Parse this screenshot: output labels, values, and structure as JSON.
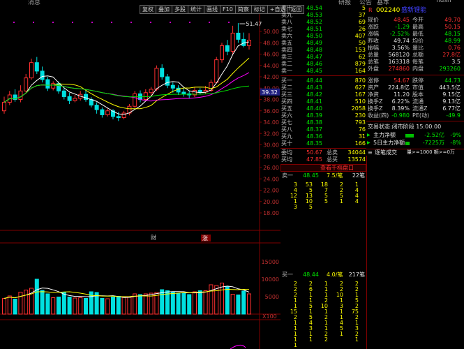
{
  "topbar": {
    "items": [
      "消息",
      "研报",
      "公告",
      "基本",
      "flush"
    ]
  },
  "toolbar": {
    "buttons": [
      "复权",
      "叠加",
      "多股",
      "统计",
      "画线",
      "F10",
      "简察",
      "标记",
      "+自选",
      "返回"
    ]
  },
  "colors": {
    "up": "#ff3030",
    "down": "#00e0e0",
    "ma1": "#ffffff",
    "ma2": "#ffff00",
    "ma3": "#ff00ff",
    "ma4": "#00e600",
    "grid": "#800000"
  },
  "chart": {
    "price_ticks": [
      "50.00",
      "48.00",
      "46.00",
      "44.00",
      "42.00",
      "40.00",
      "38.00",
      "36.00",
      "34.00",
      "32.00",
      "30.00",
      "28.00",
      "26.00",
      "24.00",
      "22.00",
      "20.00",
      "18.00"
    ],
    "current_price_tag": "39.32",
    "high_annotation": "51.47",
    "markers": [
      "财",
      "涨"
    ],
    "volume_ticks": [
      "15000",
      "10000",
      "5000"
    ],
    "volume_unit": "X100",
    "candles": [
      {
        "o": 36.0,
        "c": 37.5,
        "h": 38.5,
        "l": 35.5,
        "v": 4500
      },
      {
        "o": 37.5,
        "c": 38.8,
        "h": 39.5,
        "l": 37.0,
        "v": 5200
      },
      {
        "o": 38.8,
        "c": 38.0,
        "h": 39.8,
        "l": 37.6,
        "v": 4300
      },
      {
        "o": 38.0,
        "c": 39.5,
        "h": 40.5,
        "l": 37.5,
        "v": 6300
      },
      {
        "o": 39.5,
        "c": 41.8,
        "h": 42.5,
        "l": 39.2,
        "v": 6900
      },
      {
        "o": 41.8,
        "c": 44.5,
        "h": 45.2,
        "l": 41.5,
        "v": 7400
      },
      {
        "o": 44.5,
        "c": 43.0,
        "h": 45.5,
        "l": 42.5,
        "v": 10000
      },
      {
        "o": 43.0,
        "c": 41.5,
        "h": 43.8,
        "l": 41.0,
        "v": 6800
      },
      {
        "o": 41.5,
        "c": 40.0,
        "h": 42.0,
        "l": 39.5,
        "v": 5800
      },
      {
        "o": 40.0,
        "c": 40.8,
        "h": 41.2,
        "l": 39.6,
        "v": 4700
      },
      {
        "o": 40.8,
        "c": 39.5,
        "h": 41.2,
        "l": 39.0,
        "v": 4900
      },
      {
        "o": 39.5,
        "c": 38.5,
        "h": 40.0,
        "l": 38.0,
        "v": 6300
      },
      {
        "o": 38.5,
        "c": 37.8,
        "h": 39.2,
        "l": 37.2,
        "v": 4900
      },
      {
        "o": 37.8,
        "c": 38.2,
        "h": 38.8,
        "l": 37.5,
        "v": 4600
      },
      {
        "o": 38.2,
        "c": 38.9,
        "h": 39.5,
        "l": 37.8,
        "v": 4700
      },
      {
        "o": 38.9,
        "c": 38.0,
        "h": 39.6,
        "l": 37.6,
        "v": 4500
      },
      {
        "o": 38.0,
        "c": 37.0,
        "h": 38.4,
        "l": 36.6,
        "v": 6400
      },
      {
        "o": 37.0,
        "c": 36.2,
        "h": 37.5,
        "l": 35.5,
        "v": 6200
      },
      {
        "o": 36.2,
        "c": 35.3,
        "h": 36.6,
        "l": 34.8,
        "v": 4500
      },
      {
        "o": 35.3,
        "c": 36.0,
        "h": 36.5,
        "l": 35.0,
        "v": 4400
      },
      {
        "o": 36.0,
        "c": 35.0,
        "h": 36.3,
        "l": 34.5,
        "v": 4900
      },
      {
        "o": 35.0,
        "c": 34.8,
        "h": 35.8,
        "l": 34.2,
        "v": 5100
      },
      {
        "o": 34.8,
        "c": 35.6,
        "h": 36.0,
        "l": 34.5,
        "v": 4800
      },
      {
        "o": 35.6,
        "c": 36.8,
        "h": 37.2,
        "l": 35.2,
        "v": 4800
      },
      {
        "o": 36.8,
        "c": 39.0,
        "h": 39.5,
        "l": 36.5,
        "v": 5800
      },
      {
        "o": 39.0,
        "c": 38.0,
        "h": 39.6,
        "l": 37.5,
        "v": 5600
      },
      {
        "o": 38.0,
        "c": 39.2,
        "h": 39.8,
        "l": 37.8,
        "v": 5800
      },
      {
        "o": 39.2,
        "c": 39.8,
        "h": 40.2,
        "l": 38.6,
        "v": 6000
      },
      {
        "o": 39.8,
        "c": 43.5,
        "h": 44.0,
        "l": 39.5,
        "v": 6200
      },
      {
        "o": 43.5,
        "c": 42.0,
        "h": 44.2,
        "l": 41.5,
        "v": 7000
      },
      {
        "o": 42.0,
        "c": 40.5,
        "h": 42.5,
        "l": 40.0,
        "v": 6700
      },
      {
        "o": 40.5,
        "c": 40.0,
        "h": 41.0,
        "l": 39.2,
        "v": 6300
      },
      {
        "o": 40.0,
        "c": 39.3,
        "h": 40.5,
        "l": 38.8,
        "v": 6000
      },
      {
        "o": 39.3,
        "c": 39.0,
        "h": 40.0,
        "l": 38.5,
        "v": 6100
      },
      {
        "o": 39.0,
        "c": 38.8,
        "h": 39.5,
        "l": 38.2,
        "v": 5600
      },
      {
        "o": 38.8,
        "c": 39.6,
        "h": 40.2,
        "l": 38.4,
        "v": 6400
      },
      {
        "o": 39.6,
        "c": 39.3,
        "h": 40.0,
        "l": 38.9,
        "v": 6700
      },
      {
        "o": 39.3,
        "c": 39.6,
        "h": 40.4,
        "l": 39.0,
        "v": 6700
      },
      {
        "o": 39.6,
        "c": 41.0,
        "h": 41.5,
        "l": 39.3,
        "v": 8400
      },
      {
        "o": 41.0,
        "c": 45.0,
        "h": 45.5,
        "l": 40.8,
        "v": 8200
      },
      {
        "o": 45.0,
        "c": 47.5,
        "h": 48.0,
        "l": 44.5,
        "v": 8900
      },
      {
        "o": 47.5,
        "c": 46.5,
        "h": 48.5,
        "l": 45.8,
        "v": 7900
      },
      {
        "o": 46.5,
        "c": 49.7,
        "h": 51.0,
        "l": 46.0,
        "v": 5700
      },
      {
        "o": 49.7,
        "c": 48.6,
        "h": 51.47,
        "l": 48.0,
        "v": 5500
      },
      {
        "o": 48.6,
        "c": 47.5,
        "h": 49.8,
        "l": 47.2,
        "v": 6600
      },
      {
        "o": 47.5,
        "c": 48.45,
        "h": 49.7,
        "l": 46.8,
        "v": 5800
      }
    ]
  },
  "orderbook": {
    "sells": [
      {
        "label": "卖十",
        "price": "48.54",
        "vol": "5"
      },
      {
        "label": "卖九",
        "price": "48.53",
        "vol": "37"
      },
      {
        "label": "卖八",
        "price": "48.52",
        "vol": "69"
      },
      {
        "label": "卖七",
        "price": "48.51",
        "vol": "26"
      },
      {
        "label": "卖六",
        "price": "48.50",
        "vol": "407"
      },
      {
        "label": "卖五",
        "price": "48.49",
        "vol": "50"
      },
      {
        "label": "卖四",
        "price": "48.48",
        "vol": "153"
      },
      {
        "label": "卖三",
        "price": "48.47",
        "vol": "62"
      },
      {
        "label": "卖二",
        "price": "48.46",
        "vol": "879"
      },
      {
        "label": "卖一",
        "price": "48.45",
        "vol": "164"
      }
    ],
    "buys": [
      {
        "label": "买一",
        "price": "48.44",
        "vol": "870"
      },
      {
        "label": "买二",
        "price": "48.43",
        "vol": "627"
      },
      {
        "label": "买三",
        "price": "48.42",
        "vol": "167"
      },
      {
        "label": "买四",
        "price": "48.41",
        "vol": "510"
      },
      {
        "label": "买五",
        "price": "48.40",
        "vol": "2058"
      },
      {
        "label": "买六",
        "price": "48.39",
        "vol": "230"
      },
      {
        "label": "买七",
        "price": "48.38",
        "vol": "793"
      },
      {
        "label": "买八",
        "price": "48.37",
        "vol": "76"
      },
      {
        "label": "买九",
        "price": "48.36",
        "vol": "31"
      },
      {
        "label": "买十",
        "price": "48.35",
        "vol": "166"
      }
    ],
    "summary": [
      {
        "label": "委均",
        "price": "50.67",
        "label2": "总卖",
        "vol": "34044"
      },
      {
        "label": "买均",
        "price": "47.85",
        "label2": "总买",
        "vol": "13574"
      }
    ],
    "link_label": "查看千档盘口"
  },
  "quote": {
    "code": "002240",
    "name": "盛新锂能",
    "rows": [
      [
        "现价",
        "48.45",
        "今开",
        "49.70"
      ],
      [
        "涨跌",
        "-1.29",
        "最高",
        "50.15"
      ],
      [
        "涨幅",
        "-2.52%",
        "最低",
        "48.15"
      ],
      [
        "昨收",
        "49.74",
        "均价",
        "48.99"
      ],
      [
        "振幅",
        "3.56%",
        "量比",
        "0.76"
      ],
      [
        "总量",
        "568120",
        "总额",
        "27.8亿"
      ],
      [
        "总笔",
        "163318",
        "每笔",
        "3.5"
      ],
      [
        "外盘",
        "274860",
        "内盘",
        "293260"
      ]
    ],
    "rows2": [
      [
        "涨停",
        "54.67",
        "跌停",
        "44.73"
      ],
      [
        "资产",
        "224.8亿",
        "市值",
        "443.5亿"
      ],
      [
        "净资",
        "11.20",
        "股本",
        "9.15亿"
      ],
      [
        "换手Z",
        "6.22%",
        "流通",
        "9.13亿"
      ],
      [
        "换手Z",
        "8.39%",
        "流通Z",
        "6.77亿"
      ],
      [
        "收益(四)",
        "-0.980",
        "PE(动)",
        "-49.9"
      ]
    ],
    "trade_status": "交易状态:闭市阶段 15:00:00",
    "main_flow_label": "主力净额",
    "main_flow_value": "-2.52亿",
    "main_flow_pct": "-9%",
    "five_day_label": "5日主力净额",
    "five_day_value": "-7225万",
    "five_day_pct": "-8%"
  },
  "trade_header": {
    "title": "逐笔成交",
    "filter": "量>=1000 额>=0万"
  },
  "queue_sell": {
    "label": "卖一",
    "price": "48.45",
    "count": "7.5/笔",
    "total": "22笔",
    "rows": [
      [
        "3",
        "53",
        "18",
        "2",
        "1"
      ],
      [
        "4",
        "5",
        "7",
        "2",
        "4"
      ],
      [
        "12",
        "13",
        "5",
        "5",
        "4"
      ],
      [
        "1",
        "10",
        "5",
        "1",
        "4"
      ],
      [
        "3",
        "5",
        "",
        "",
        ""
      ]
    ]
  },
  "queue_buy": {
    "label": "买一",
    "price": "48.44",
    "count": "4.0/笔",
    "total": "217笔",
    "rows": [
      [
        "2",
        "2",
        "1",
        "2",
        "2"
      ],
      [
        "2",
        "6",
        "1",
        "2",
        "2"
      ],
      [
        "2",
        "1",
        "1",
        "10",
        "1"
      ],
      [
        "1",
        "1",
        "2",
        "1",
        "5"
      ],
      [
        "1",
        "5",
        "10",
        "3",
        "2"
      ],
      [
        "15",
        "1",
        "1",
        "1",
        "75"
      ],
      [
        "2",
        "5",
        "2",
        "1",
        "2"
      ],
      [
        "1",
        "4",
        "1",
        "4",
        "1"
      ],
      [
        "1",
        "3",
        "1",
        "5",
        "3"
      ],
      [
        "1",
        "1",
        "2",
        "1",
        "2"
      ],
      [
        "1",
        "1",
        "2",
        "",
        "1"
      ],
      [
        "1",
        "",
        "",
        "",
        ""
      ]
    ]
  }
}
